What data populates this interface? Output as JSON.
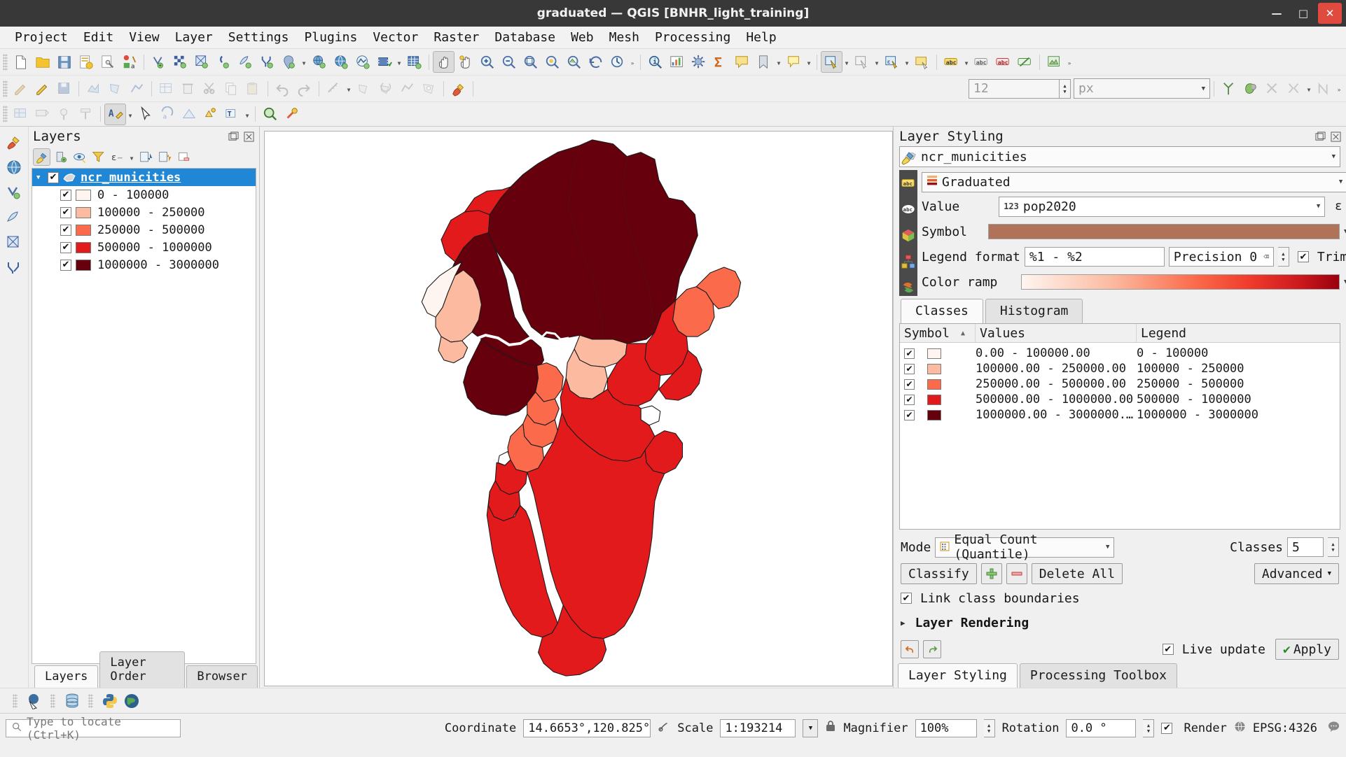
{
  "window": {
    "title": "graduated — QGIS [BNHR_light_training]",
    "minimize": "—",
    "maximize": "□",
    "close": "✕"
  },
  "menubar": {
    "items": [
      "Project",
      "Edit",
      "View",
      "Layer",
      "Settings",
      "Plugins",
      "Vector",
      "Raster",
      "Database",
      "Web",
      "Mesh",
      "Processing",
      "Help"
    ]
  },
  "layers_panel": {
    "title": "Layers",
    "toolbar_icons": [
      "open-layer-styling-panel-icon",
      "add-group-icon",
      "manage-map-themes-icon",
      "filter-legend-icon",
      "expression-filter-icon",
      "expand-all-icon",
      "collapse-all-icon",
      "remove-layer-icon"
    ],
    "layer": {
      "name": "ncr_municities",
      "checked": true,
      "expanded": true,
      "icon": "polygon-layer-icon"
    },
    "classes": [
      {
        "label": "0 - 100000",
        "color": "#fff5f0",
        "checked": true
      },
      {
        "label": "100000 - 250000",
        "color": "#fcbba1",
        "checked": true
      },
      {
        "label": "250000 - 500000",
        "color": "#fb6a4a",
        "checked": true
      },
      {
        "label": "500000 - 1000000",
        "color": "#e31a1c",
        "checked": true
      },
      {
        "label": "1000000 - 3000000",
        "color": "#67000d",
        "checked": true
      }
    ],
    "tabs": [
      {
        "label": "Layers",
        "active": true
      },
      {
        "label": "Layer Order",
        "active": false
      },
      {
        "label": "Browser",
        "active": false
      }
    ]
  },
  "style_panel": {
    "title": "Layer Styling",
    "layer_selector": "ncr_municities",
    "renderer": "Graduated",
    "value_label": "Value",
    "value_field": "pop2020",
    "value_field_prefix": "123",
    "symbol_label": "Symbol",
    "symbol_color": "#b07258",
    "legend_format_label": "Legend format",
    "legend_format_value": "%1 - %2",
    "precision_label": "Precision 0",
    "trim_label": "Trim",
    "trim_checked": true,
    "color_ramp_label": "Color ramp",
    "tabs": [
      {
        "label": "Classes",
        "active": true
      },
      {
        "label": "Histogram",
        "active": false
      }
    ],
    "table": {
      "headers": [
        "Symbol",
        "Values",
        "Legend"
      ],
      "sort_indicator": "▲",
      "rows": [
        {
          "checked": true,
          "color": "#fff5f0",
          "values": "0.00 - 100000.00",
          "legend": "0 - 100000"
        },
        {
          "checked": true,
          "color": "#fcbba1",
          "values": "100000.00 - 250000.00",
          "legend": "100000 - 250000"
        },
        {
          "checked": true,
          "color": "#fb6a4a",
          "values": "250000.00 - 500000.00",
          "legend": "250000 - 500000"
        },
        {
          "checked": true,
          "color": "#e31a1c",
          "values": "500000.00 - 1000000.00",
          "legend": "500000 - 1000000"
        },
        {
          "checked": true,
          "color": "#67000d",
          "values": "1000000.00 - 3000000.…",
          "legend": "1000000 - 3000000"
        }
      ]
    },
    "mode_label": "Mode",
    "mode_value": "Equal Count (Quantile)",
    "classes_label": "Classes",
    "classes_value": "5",
    "classify_button": "Classify",
    "add_class_button": "+",
    "remove_class_button": "−",
    "delete_all_button": "Delete All",
    "advanced_button": "Advanced",
    "link_class_boundaries_label": "Link class boundaries",
    "link_class_boundaries_checked": true,
    "layer_rendering_label": "Layer Rendering",
    "live_update_label": "Live update",
    "live_update_checked": true,
    "apply_button": "Apply",
    "bottom_tabs": [
      {
        "label": "Layer Styling",
        "active": true
      },
      {
        "label": "Processing Toolbox",
        "active": false
      }
    ]
  },
  "toolbar_third": {
    "font_size": "12",
    "units": "px"
  },
  "statusbar": {
    "locate_placeholder": "Type to locate (Ctrl+K)",
    "coordinate_label": "Coordinate",
    "coordinate_value": "14.6653°,120.825°",
    "scale_label": "Scale",
    "scale_value": "1:193214",
    "magnifier_label": "Magnifier",
    "magnifier_value": "100%",
    "rotation_label": "Rotation",
    "rotation_value": "0.0 °",
    "render_label": "Render",
    "render_checked": true,
    "crs_label": "EPSG:4326"
  },
  "map": {
    "background": "#ffffff",
    "fill_palette": [
      "#fff5f0",
      "#fcbba1",
      "#fb6a4a",
      "#e31a1c",
      "#67000d"
    ],
    "stroke": "#1a1a1a"
  }
}
